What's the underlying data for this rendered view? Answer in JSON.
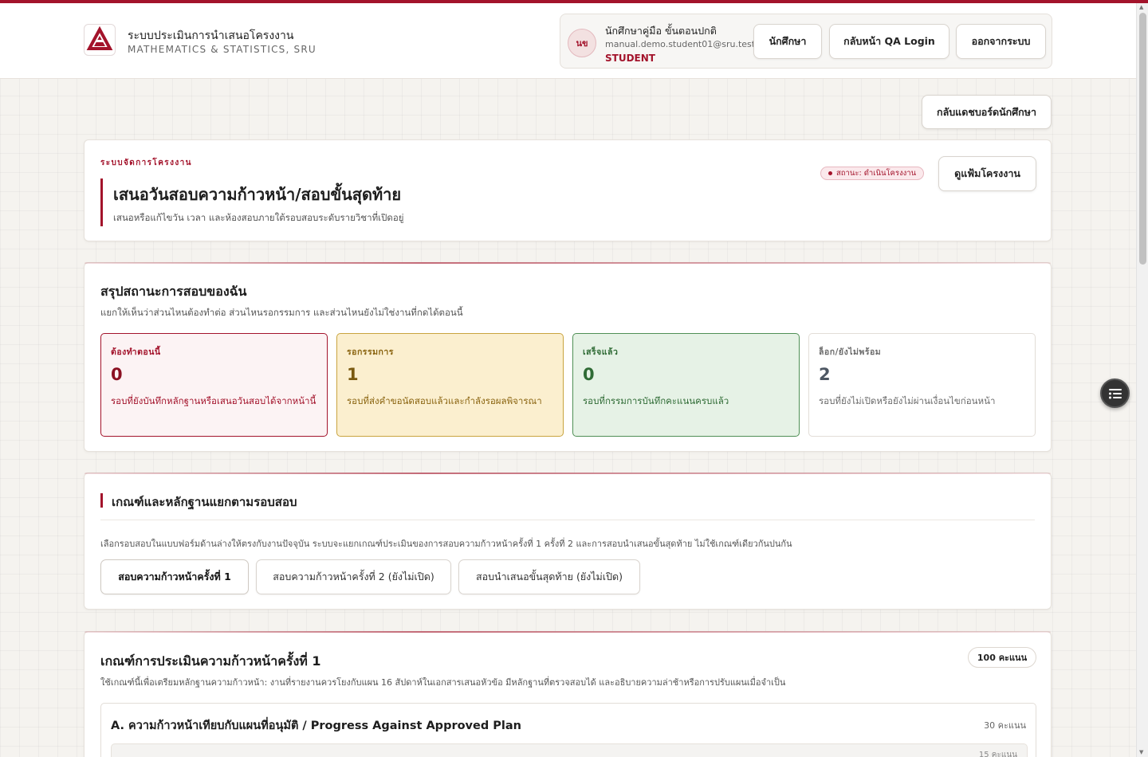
{
  "brand": {
    "title": "ระบบประเมินการนำเสนอโครงงาน",
    "subtitle": "MATHEMATICS & STATISTICS, SRU",
    "accent": "#a3132b"
  },
  "user": {
    "initials": "นข",
    "name": "นักศึกษาคู่มือ ขั้นตอนปกติ",
    "email": "manual.demo.student01@sru.test",
    "role": "STUDENT"
  },
  "header_buttons": {
    "student": "นักศึกษา",
    "qa_login": "กลับหน้า QA Login",
    "logout": "ออกจากระบบ"
  },
  "back_dashboard": "กลับแดชบอร์ดนักศึกษา",
  "hero": {
    "eyebrow": "ระบบจัดการโครงงาน",
    "title": "เสนอวันสอบความก้าวหน้า/สอบขั้นสุดท้าย",
    "subtitle": "เสนอหรือแก้ไขวัน เวลา และห้องสอบภายใต้รอบสอบระดับรายวิชาที่เปิดอยู่",
    "status": "สถานะ: ดำเนินโครงงาน",
    "view_portfolio": "ดูแฟ้มโครงงาน"
  },
  "summary": {
    "title": "สรุปสถานะการสอบของฉัน",
    "description": "แยกให้เห็นว่าส่วนไหนต้องทำต่อ ส่วนไหนรอกรรมการ และส่วนไหนยังไม่ใช่งานที่กดได้ตอนนี้",
    "stats": [
      {
        "label": "ต้องทำตอนนี้",
        "value": "0",
        "desc": "รอบที่ยังบันทึกหลักฐานหรือเสนอวันสอบได้จากหน้านี้"
      },
      {
        "label": "รอกรรมการ",
        "value": "1",
        "desc": "รอบที่ส่งคำขอนัดสอบแล้วและกำลังรอผลพิจารณา"
      },
      {
        "label": "เสร็จแล้ว",
        "value": "0",
        "desc": "รอบที่กรรมการบันทึกคะแนนครบแล้ว"
      },
      {
        "label": "ล็อก/ยังไม่พร้อม",
        "value": "2",
        "desc": "รอบที่ยังไม่เปิดหรือยังไม่ผ่านเงื่อนไขก่อนหน้า"
      }
    ]
  },
  "criteria_section": {
    "title": "เกณฑ์และหลักฐานแยกตามรอบสอบ",
    "description": "เลือกรอบสอบในแบบฟอร์มด้านล่างให้ตรงกับงานปัจจุบัน ระบบจะแยกเกณฑ์ประเมินของการสอบความก้าวหน้าครั้งที่ 1 ครั้งที่ 2 และการสอบนำเสนอขั้นสุดท้าย ไม่ใช้เกณฑ์เดียวกันปนกัน",
    "tabs": [
      "สอบความก้าวหน้าครั้งที่ 1",
      "สอบความก้าวหน้าครั้งที่ 2 (ยังไม่เปิด)",
      "สอบนำเสนอขั้นสุดท้าย (ยังไม่เปิด)"
    ]
  },
  "rubric": {
    "title": "เกณฑ์การประเมินความก้าวหน้าครั้งที่ 1",
    "points": "100 คะแนน",
    "description": "ใช้เกณฑ์นี้เพื่อเตรียมหลักฐานความก้าวหน้า: งานที่รายงานควรโยงกับแผน 16 สัปดาห์ในเอกสารเสนอหัวข้อ มีหลักฐานที่ตรวจสอบได้ และอธิบายความล่าช้าหรือการปรับแผนเมื่อจำเป็น",
    "section_a": {
      "title": "A. ความก้าวหน้าเทียบกับแผนที่อนุมัติ / Progress Against Approved Plan",
      "points": "30 คะแนน",
      "item_points": "15 คะแนน"
    }
  }
}
